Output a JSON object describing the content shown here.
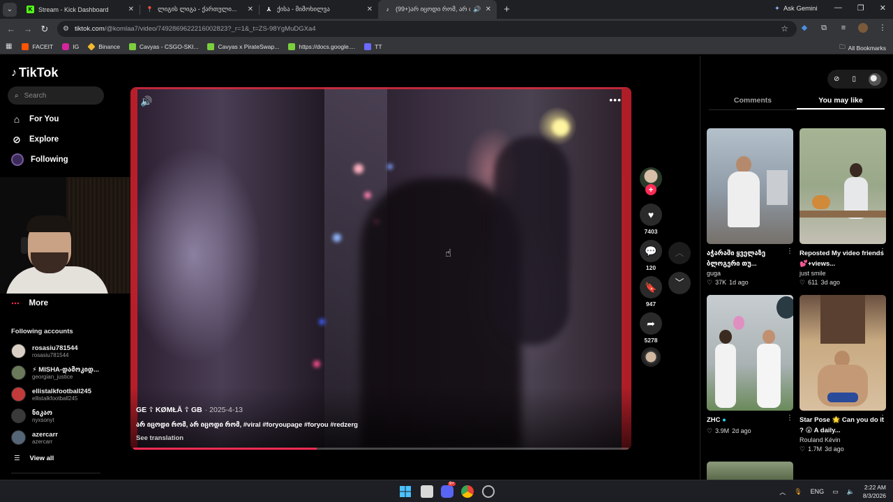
{
  "browser": {
    "tabs": [
      {
        "title": "Stream - Kick Dashboard",
        "favicon": "kick-icon",
        "color": "#53fc18",
        "active": false
      },
      {
        "title": "ლიგის ლიგა - ქართული...",
        "favicon": "pin-icon",
        "color": "#e53935",
        "active": false
      },
      {
        "title": "ქისა - მიმოხილვა",
        "favicon": "game-icon",
        "color": "#ffffff",
        "active": false
      },
      {
        "title": "(99+)არ იცოდი რომ, არ იცოდი...",
        "favicon": "tiktok-icon",
        "color": "#ffffff",
        "active": true
      }
    ],
    "ask_gemini": "Ask Gemini",
    "url_main": "tiktok.com",
    "url_rest": "/@komlaa7/video/7492869622216002823?_r=1&_t=ZS-98YgMuDGXa4",
    "bookmarks": [
      {
        "label": "FACEIT",
        "color": "#ff5500"
      },
      {
        "label": "IG",
        "color": "#d6249f"
      },
      {
        "label": "Binance",
        "color": "#f3ba2f"
      },
      {
        "label": "Cavyas - CSGO-SKI...",
        "color": "#7ccf3c"
      },
      {
        "label": "Cavyas x PirateSwap...",
        "color": "#7ccf3c"
      },
      {
        "label": "https://docs.google....",
        "color": "#7ccf3c"
      },
      {
        "label": "TT",
        "color": "#6a6aff"
      }
    ],
    "all_bookmarks": "All Bookmarks"
  },
  "tiktok": {
    "logo": "TikTok",
    "search_placeholder": "Search",
    "nav": [
      {
        "label": "For You",
        "icon": "home-icon"
      },
      {
        "label": "Explore",
        "icon": "compass-icon"
      },
      {
        "label": "Following",
        "icon": "following-icon"
      }
    ],
    "more": "More",
    "following_heading": "Following accounts",
    "accounts": [
      {
        "name": "rosasiu781544",
        "handle": "rosasiu781544",
        "color": "#d9cfc4"
      },
      {
        "name": "⚡ MISHA-დამოკიდ...",
        "handle": "georgian_justice",
        "color": "#6a7a5a"
      },
      {
        "name": "ellistalkfootball245",
        "handle": "ellistalkfootball245",
        "color": "#c23a3a"
      },
      {
        "name": "ნიკაო",
        "handle": "nyxsonyt",
        "color": "#3a3a3a"
      },
      {
        "name": "azercarr",
        "handle": "azercarr",
        "color": "#556677"
      }
    ],
    "view_all": "View all",
    "video": {
      "author": "GE ☦ KØMŁĀ ☦ GB",
      "date": "· 2025-4-13",
      "description": "არ იცოდი რომ, არ იცოდი რომ, #viral #foryoupage #foryou #redzerg",
      "see_translation": "See translation",
      "progress": 0.37
    },
    "actions": {
      "likes": "7403",
      "comments": "120",
      "saves": "947",
      "shares": "5278"
    },
    "right_tabs": [
      "Comments",
      "You may like"
    ],
    "suggestions": [
      {
        "title": "აჭარაში ყველაზე ბლოგერი თუ...",
        "author": "guga",
        "likes": "37K",
        "age": "1d ago",
        "bg": "#8e9aa6"
      },
      {
        "title": "Reposted My video friends💕+views...",
        "author": "just smile",
        "likes": "611",
        "age": "3d ago",
        "bg": "#9aa88a"
      },
      {
        "title": "ZHC",
        "author": "",
        "likes": "3.9M",
        "age": "2d ago",
        "bg": "#b0b6b4"
      },
      {
        "title": "Star Pose 🌟 Can you do it ? 😮 A daily...",
        "author": "Rouland Kévin",
        "likes": "1.7M",
        "age": "3d ago",
        "bg": "#c8aa82"
      }
    ]
  },
  "taskbar": {
    "lang": "ENG",
    "time": "2:22 AM",
    "date": "8/3/2026",
    "discord_badge": "9+"
  }
}
